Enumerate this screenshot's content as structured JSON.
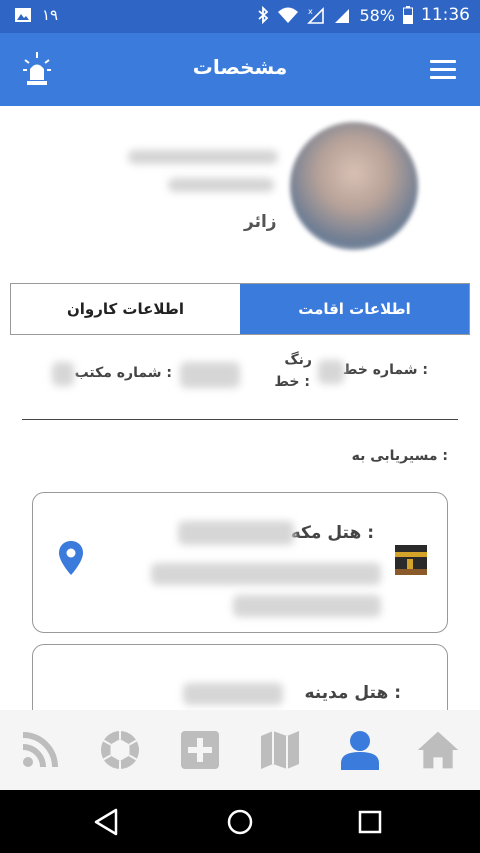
{
  "status_bar": {
    "notification_count": "۱۹",
    "battery": "58%",
    "time": "11:36",
    "icons": [
      "image-icon",
      "bluetooth-icon",
      "wifi-icon",
      "no-signal-icon",
      "signal-icon",
      "battery-icon"
    ]
  },
  "app_bar": {
    "title": "مشخصات",
    "menu_icon": "hamburger-menu-icon",
    "alert_icon": "siren-icon"
  },
  "profile": {
    "role": "زائر"
  },
  "tabs": [
    {
      "label": "اطلاعات اقامت",
      "active": true
    },
    {
      "label": "اطلاعات کاروان",
      "active": false
    }
  ],
  "line_info": {
    "line_number_label": "شماره خط :",
    "line_color_label_1": "رنگ",
    "line_color_label_2": "خط :",
    "office_number_label": "شماره مکتب :"
  },
  "routing": {
    "label": "مسیریابی به :"
  },
  "hotels": [
    {
      "label": "هتل مکه :",
      "icon": "kaaba-icon",
      "location_icon": "location-pin-icon"
    },
    {
      "label": "هتل مدینه :"
    }
  ],
  "bottom_nav": [
    {
      "name": "rss-icon"
    },
    {
      "name": "camera-shutter-icon"
    },
    {
      "name": "add-box-icon"
    },
    {
      "name": "map-icon"
    },
    {
      "name": "person-icon",
      "active": true
    },
    {
      "name": "home-icon"
    }
  ],
  "colors": {
    "primary": "#3a7bdc",
    "status_bar": "#2f66c5",
    "nav_inactive": "#bdbdbd",
    "nav_active": "#3a7bdc"
  }
}
